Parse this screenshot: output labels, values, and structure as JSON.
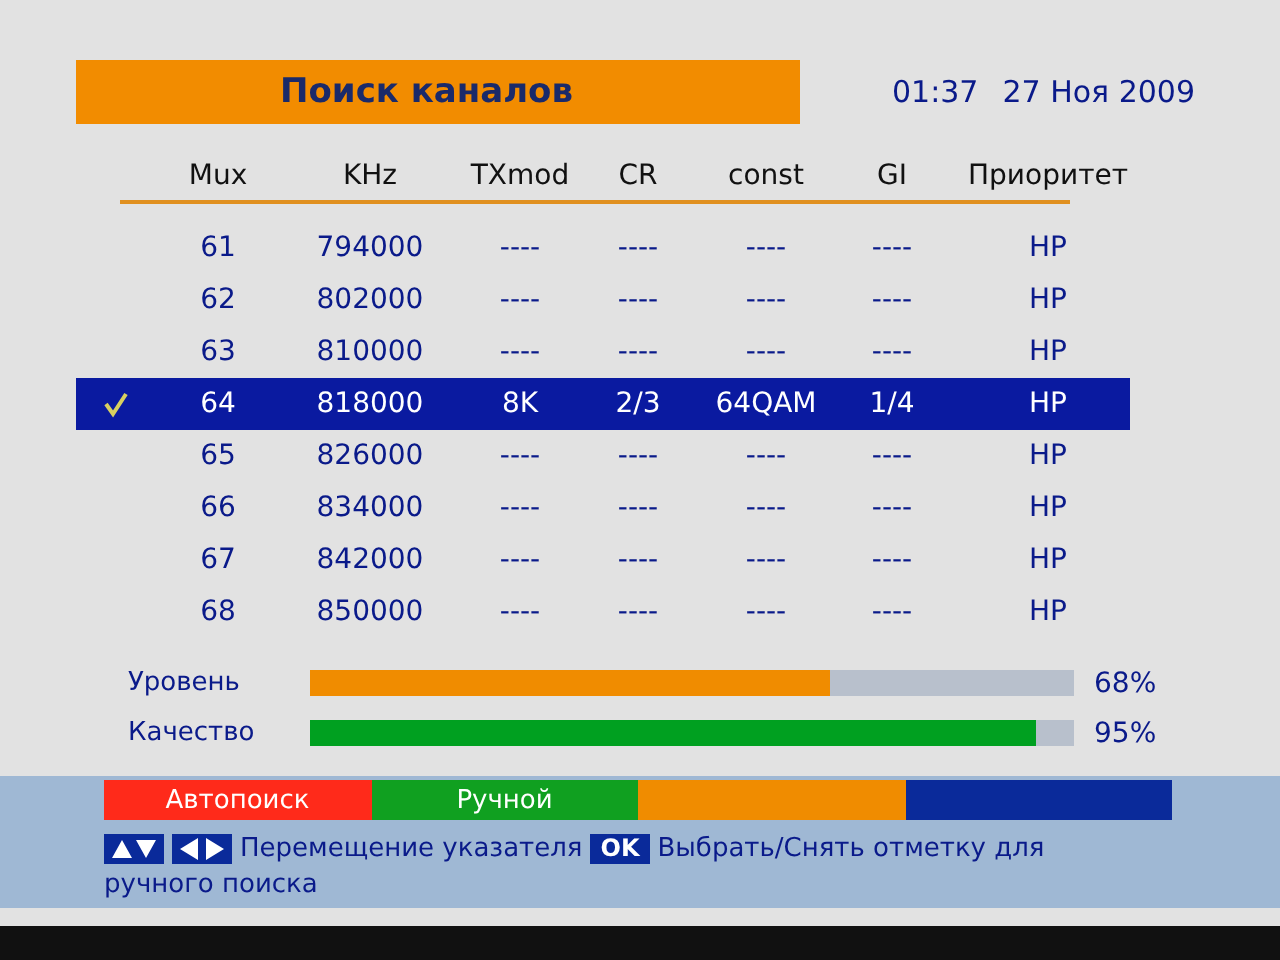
{
  "title": "Поиск каналов",
  "clock": {
    "time": "01:37",
    "date": "27 Ноя 2009"
  },
  "table": {
    "columns": [
      "Mux",
      "KHz",
      "TXmod",
      "CR",
      "const",
      "GI",
      "Приоритет"
    ],
    "rows": [
      {
        "cells": [
          "61",
          "794000",
          "----",
          "----",
          "----",
          "----",
          "HP"
        ],
        "selected": false,
        "checked": false
      },
      {
        "cells": [
          "62",
          "802000",
          "----",
          "----",
          "----",
          "----",
          "HP"
        ],
        "selected": false,
        "checked": false
      },
      {
        "cells": [
          "63",
          "810000",
          "----",
          "----",
          "----",
          "----",
          "HP"
        ],
        "selected": false,
        "checked": false
      },
      {
        "cells": [
          "64",
          "818000",
          "8K",
          "2/3",
          "64QAM",
          "1/4",
          "HP"
        ],
        "selected": true,
        "checked": true
      },
      {
        "cells": [
          "65",
          "826000",
          "----",
          "----",
          "----",
          "----",
          "HP"
        ],
        "selected": false,
        "checked": false
      },
      {
        "cells": [
          "66",
          "834000",
          "----",
          "----",
          "----",
          "----",
          "HP"
        ],
        "selected": false,
        "checked": false
      },
      {
        "cells": [
          "67",
          "842000",
          "----",
          "----",
          "----",
          "----",
          "HP"
        ],
        "selected": false,
        "checked": false
      },
      {
        "cells": [
          "68",
          "850000",
          "----",
          "----",
          "----",
          "----",
          "HP"
        ],
        "selected": false,
        "checked": false
      }
    ]
  },
  "meters": [
    {
      "label": "Уровень",
      "level": 0.68,
      "reading": "68%",
      "color": "#f08c00"
    },
    {
      "label": "Качество",
      "level": 0.95,
      "reading": "95%",
      "color": "#00a020"
    }
  ],
  "color_keys": [
    {
      "label": "Автопоиск",
      "color": "#ff2a1a"
    },
    {
      "label": "Ручной",
      "color": "#10a020"
    },
    {
      "color": "#f08c00"
    },
    {
      "color": "#0a2a9a"
    }
  ],
  "help": {
    "move_text": "Перемещение указателя",
    "ok_key": "OK",
    "ok_text": "Выбрать/Снять отметку для ручного поиска"
  }
}
